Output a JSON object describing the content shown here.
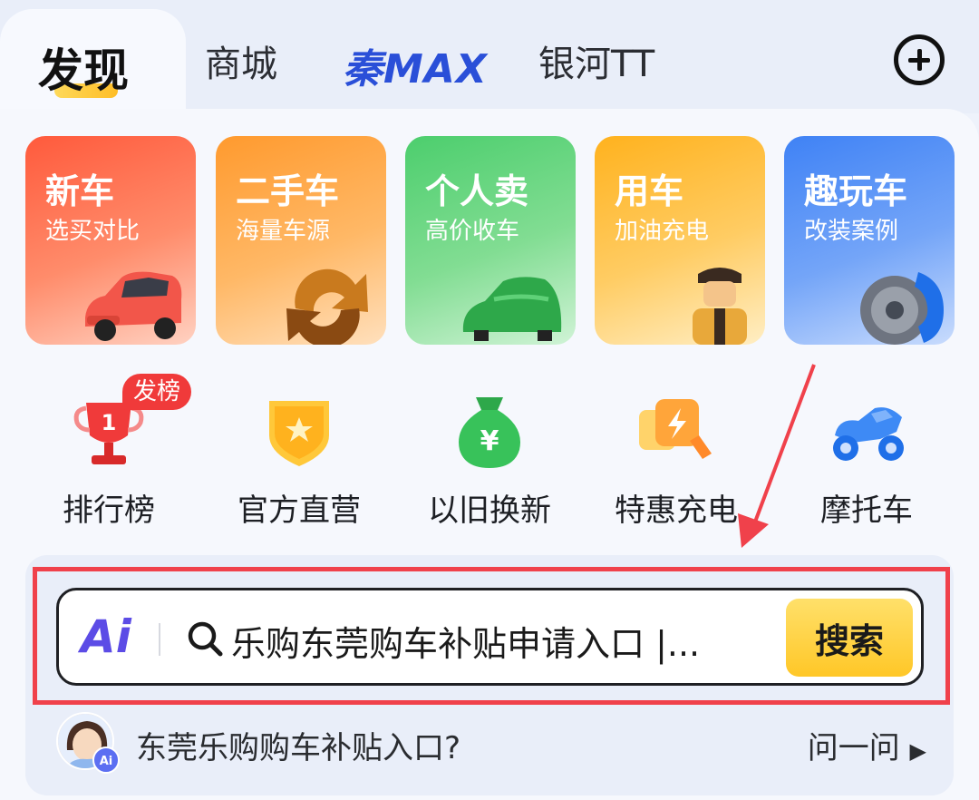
{
  "tabs": {
    "items": [
      {
        "label": "发现"
      },
      {
        "label": "商城"
      },
      {
        "label": "秦MAX"
      },
      {
        "label": "银河TT"
      }
    ]
  },
  "cards": [
    {
      "title": "新车",
      "subtitle": "选买对比"
    },
    {
      "title": "二手车",
      "subtitle": "海量车源"
    },
    {
      "title": "个人卖",
      "subtitle": "高价收车"
    },
    {
      "title": "用车",
      "subtitle": "加油充电"
    },
    {
      "title": "趣玩车",
      "subtitle": "改装案例"
    }
  ],
  "quick": [
    {
      "label": "排行榜",
      "badge": "发榜",
      "icon": "trophy-icon"
    },
    {
      "label": "官方直营",
      "icon": "shield-star-icon"
    },
    {
      "label": "以旧换新",
      "icon": "money-bag-icon"
    },
    {
      "label": "特惠充电",
      "icon": "charging-icon"
    },
    {
      "label": "摩托车",
      "icon": "motorcycle-icon"
    }
  ],
  "search": {
    "ai_label": "Ai",
    "query": "乐购东莞购车补贴申请入口 |...",
    "button": "搜索"
  },
  "ask": {
    "question": "东莞乐购购车补贴入口?",
    "link": "问一问",
    "avatar_badge": "Ai"
  },
  "colors": {
    "accent_yellow": "#ffc727",
    "annotation_red": "#f0414b",
    "brand_blue": "#2a4fd8"
  }
}
